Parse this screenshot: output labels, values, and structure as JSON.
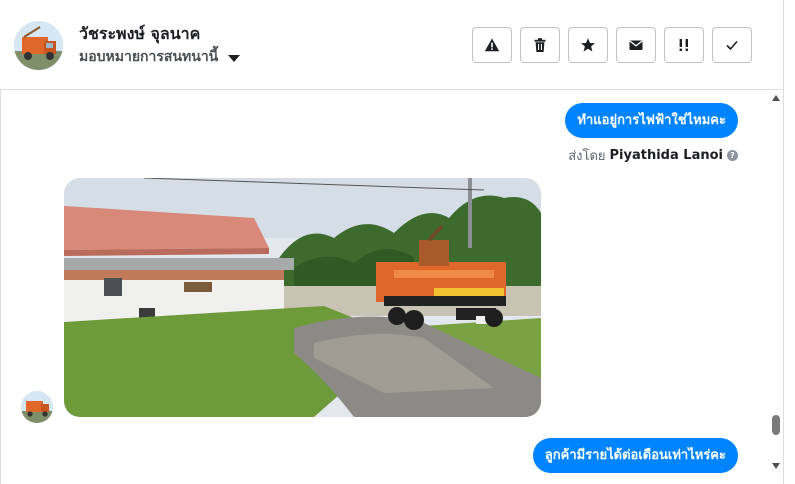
{
  "header": {
    "contact_name": "วัชระพงษ์ จุลนาค",
    "assign_label": "มอบหมายการสนทนานี้",
    "actions": [
      {
        "icon": "warning-icon",
        "label": "spam"
      },
      {
        "icon": "trash-icon",
        "label": "delete"
      },
      {
        "icon": "star-icon",
        "label": "star"
      },
      {
        "icon": "envelope-icon",
        "label": "mark unread"
      },
      {
        "icon": "follow-up-icon",
        "label": "follow up"
      },
      {
        "icon": "check-icon",
        "label": "done"
      }
    ]
  },
  "messages": {
    "outgoing_1": "ทำแอยู่การไฟฟ้าใช่ไหมคะ",
    "sent_by_prefix": "ส่งโดย",
    "sent_by_name": "Piyathida Lanoi",
    "help_glyph": "?",
    "outgoing_2": "ลูกค้ามีรายได้ต่อเดือนเท่าไหร่คะ"
  },
  "colors": {
    "bubble": "#0084ff",
    "border": "#dadde1",
    "truck": "#e0672a"
  }
}
